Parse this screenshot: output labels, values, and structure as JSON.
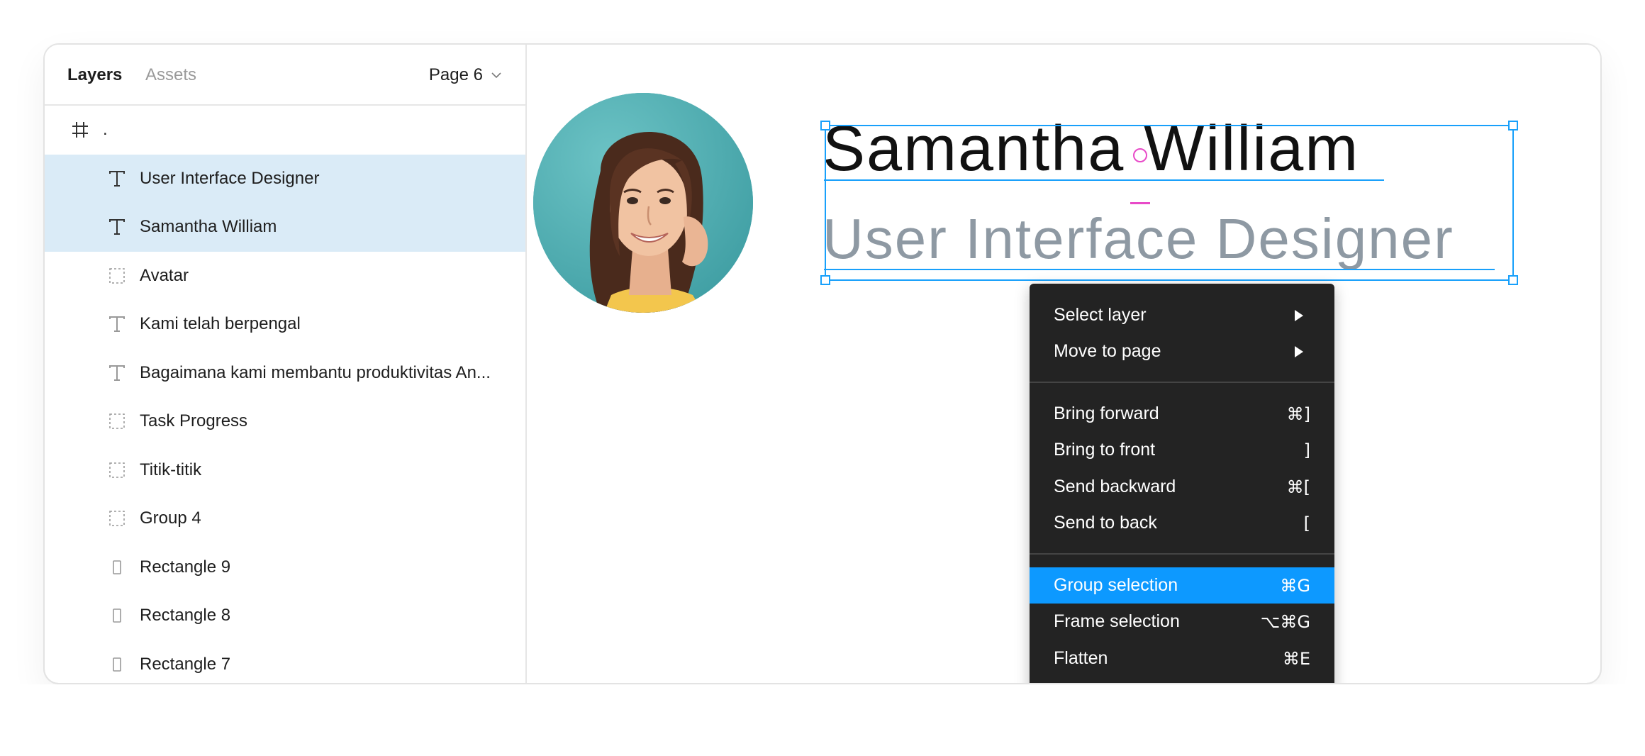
{
  "panel": {
    "tabs": {
      "layers": "Layers",
      "assets": "Assets"
    },
    "page_select": "Page 6",
    "layers": [
      {
        "icon": "frame-icon",
        "label": "."
      },
      {
        "icon": "text-icon",
        "label": "User Interface Designer"
      },
      {
        "icon": "text-icon",
        "label": "Samantha William"
      },
      {
        "icon": "group-icon",
        "label": "Avatar"
      },
      {
        "icon": "text-icon",
        "label": "Kami telah berpengal"
      },
      {
        "icon": "text-icon",
        "label": "Bagaimana kami membantu produktivitas An..."
      },
      {
        "icon": "group-icon",
        "label": "Task Progress"
      },
      {
        "icon": "group-icon",
        "label": "Titik-titik"
      },
      {
        "icon": "group-icon",
        "label": "Group 4"
      },
      {
        "icon": "rectangle-icon",
        "label": "Rectangle 9"
      },
      {
        "icon": "rectangle-icon",
        "label": "Rectangle 8"
      },
      {
        "icon": "rectangle-icon",
        "label": "Rectangle 7"
      }
    ]
  },
  "canvas": {
    "name": "Samantha William",
    "role": "User Interface Designer"
  },
  "context_menu": {
    "items": [
      {
        "label": "Select layer",
        "submenu": true
      },
      {
        "label": "Move to page",
        "submenu": true
      },
      {
        "label": "Bring forward",
        "shortcut": "⌘]"
      },
      {
        "label": "Bring to front",
        "shortcut": "]"
      },
      {
        "label": "Send backward",
        "shortcut": "⌘["
      },
      {
        "label": "Send to back",
        "shortcut": "["
      },
      {
        "label": "Group selection",
        "shortcut": "⌘G",
        "highlighted": true
      },
      {
        "label": "Frame selection",
        "shortcut": "⌥⌘G"
      },
      {
        "label": "Flatten",
        "shortcut": "⌘E"
      }
    ]
  },
  "colors": {
    "selection": "#18a0fb",
    "selected_row": "#daebf7",
    "menu_bg": "#232323",
    "menu_highlight": "#0d99ff",
    "avatar_bg": "#5ab5b8"
  }
}
